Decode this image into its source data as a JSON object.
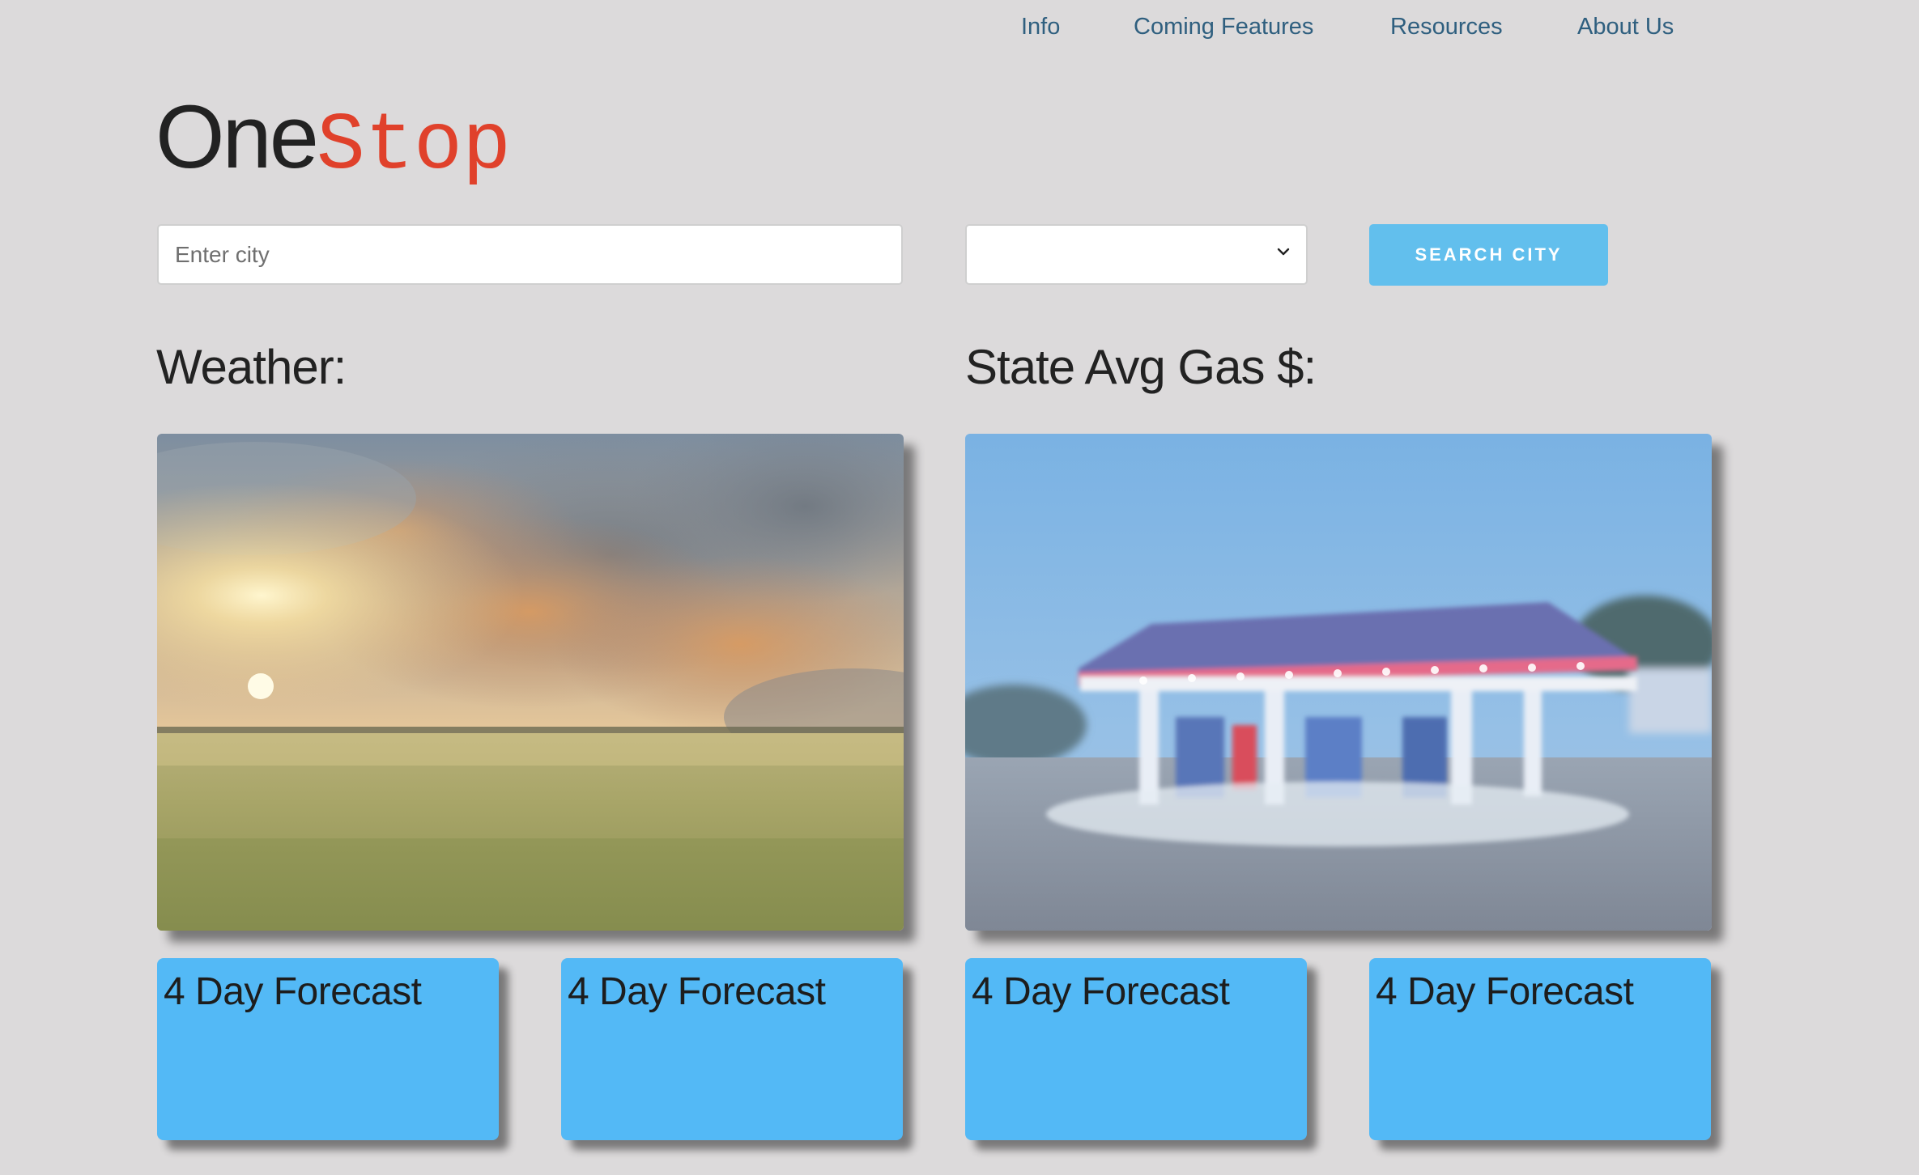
{
  "nav": {
    "items": [
      {
        "label": "Info"
      },
      {
        "label": "Coming Features"
      },
      {
        "label": "Resources"
      },
      {
        "label": "About Us"
      }
    ]
  },
  "logo": {
    "part1": "One",
    "part2": "Stop"
  },
  "search": {
    "city_placeholder": "Enter city",
    "city_value": "",
    "state_selected": "",
    "button_label": "SEARCH CITY"
  },
  "sections": {
    "weather_title": "Weather:",
    "gas_title": "State Avg Gas $:"
  },
  "cards": [
    {
      "title": "4 Day Forecast"
    },
    {
      "title": "4 Day Forecast"
    },
    {
      "title": "4 Day Forecast"
    },
    {
      "title": "4 Day Forecast"
    }
  ],
  "colors": {
    "page_background": "#dcdadb",
    "nav_link": "#2f5f7f",
    "logo_accent": "#e0412b",
    "button": "#62bfed",
    "card": "#53b9f6"
  },
  "icons": {
    "select": "chevron-down-icon"
  }
}
